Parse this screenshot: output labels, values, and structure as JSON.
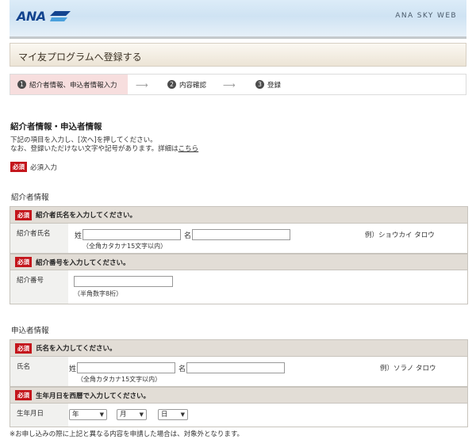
{
  "header": {
    "logo_text": "ANA",
    "brand": "ANA SKY WEB"
  },
  "page_title": "マイ友プログラムへ登録する",
  "steps": [
    {
      "num": "1",
      "label": "紹介者情報、申込者情報入力"
    },
    {
      "num": "2",
      "label": "内容確認"
    },
    {
      "num": "3",
      "label": "登録"
    }
  ],
  "section": {
    "title": "紹介者情報・申込者情報",
    "intro_line1": "下記の項目を入力し、[次へ]を押してください。",
    "intro_line2": "なお、登録いただけない文字や記号があります。詳細は",
    "intro_link": "こちら",
    "required_badge": "必須",
    "required_legend": "必須入力"
  },
  "referrer": {
    "group_label": "紹介者情報",
    "name_heading": "紹介者氏名を入力してください。",
    "name_row_label": "紹介者氏名",
    "last_label": "姓",
    "first_label": "名",
    "name_note": "（全角カタカナ15文字以内）",
    "name_example": "例）ショウカイ タロウ",
    "number_heading": "紹介番号を入力してください。",
    "number_row_label": "紹介番号",
    "number_note": "（半角数字8桁）"
  },
  "applicant": {
    "group_label": "申込者情報",
    "name_heading": "氏名を入力してください。",
    "name_row_label": "氏名",
    "last_label": "姓",
    "first_label": "名",
    "name_note": "（全角カタカナ15文字以内）",
    "name_example": "例）ソラノ タロウ",
    "dob_heading": "生年月日を西暦で入力してください。",
    "dob_row_label": "生年月日",
    "year": "年",
    "month": "月",
    "day": "日"
  },
  "footer_note": "※お申し込みの際に上記と異なる内容を申請した場合は、対象外となります。"
}
